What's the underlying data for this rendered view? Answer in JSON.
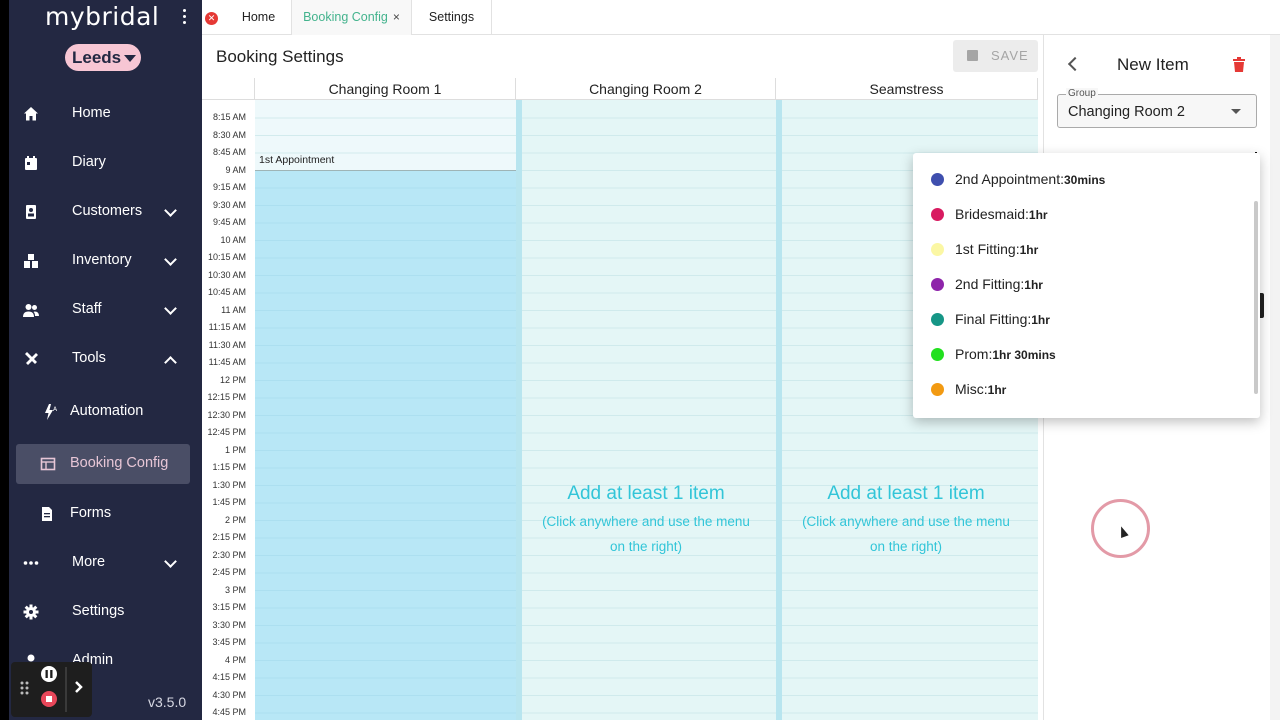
{
  "app": {
    "logo": "mybridal",
    "location": "Leeds",
    "version": "v3.5.0"
  },
  "sidebar": {
    "items": [
      {
        "label": "Home",
        "icon": "home-icon"
      },
      {
        "label": "Diary",
        "icon": "calendar-icon"
      },
      {
        "label": "Customers",
        "icon": "contact-icon"
      },
      {
        "label": "Inventory",
        "icon": "boxes-icon"
      },
      {
        "label": "Staff",
        "icon": "people-icon"
      },
      {
        "label": "Tools",
        "icon": "tools-icon"
      },
      {
        "label": "Automation",
        "icon": "automation-icon"
      },
      {
        "label": "Booking Config",
        "icon": "table-icon"
      },
      {
        "label": "Forms",
        "icon": "document-icon"
      },
      {
        "label": "More",
        "icon": "more-icon"
      },
      {
        "label": "Settings",
        "icon": "gear-icon"
      },
      {
        "label": "Admin",
        "icon": "person-icon"
      }
    ]
  },
  "tabs": [
    {
      "label": "Home"
    },
    {
      "label": "Booking Config",
      "close": "×"
    },
    {
      "label": "Settings"
    }
  ],
  "main": {
    "title": "Booking Settings",
    "save_label": "SAVE",
    "columns": [
      "Changing Room 1",
      "Changing Room 2",
      "Seamstress"
    ],
    "times": [
      "8:15 AM",
      "8:30 AM",
      "8:45 AM",
      "9 AM",
      "9:15 AM",
      "9:30 AM",
      "9:45 AM",
      "10 AM",
      "10:15 AM",
      "10:30 AM",
      "10:45 AM",
      "11 AM",
      "11:15 AM",
      "11:30 AM",
      "11:45 AM",
      "12 PM",
      "12:15 PM",
      "12:30 PM",
      "12:45 PM",
      "1 PM",
      "1:15 PM",
      "1:30 PM",
      "1:45 PM",
      "2 PM",
      "2:15 PM",
      "2:30 PM",
      "2:45 PM",
      "3 PM",
      "3:15 PM",
      "3:30 PM",
      "3:45 PM",
      "4 PM",
      "4:15 PM",
      "4:30 PM",
      "4:45 PM"
    ],
    "appointment": "1st Appointment",
    "empty_title": "Add at least 1 item",
    "empty_hint_1": "(Click anywhere and use the menu",
    "empty_hint_2": "on the right)",
    "colors": {
      "filled": "#b8e7f6",
      "empty": "#e4f6f6",
      "accent": "#32c5d8"
    }
  },
  "panel": {
    "title": "New Item",
    "group_label": "Group",
    "group_value": "Changing Room 2"
  },
  "dropdown": [
    {
      "name": "2nd Appointment:",
      "duration": "30mins",
      "color": "#3f4fae"
    },
    {
      "name": "Bridesmaid:",
      "duration": "1hr",
      "color": "#d81b60"
    },
    {
      "name": "1st Fitting:",
      "duration": "1hr",
      "color": "#fbf7a4"
    },
    {
      "name": "2nd Fitting:",
      "duration": "1hr",
      "color": "#8e24aa"
    },
    {
      "name": "Final Fitting:",
      "duration": "1hr",
      "color": "#169686"
    },
    {
      "name": "Prom:",
      "duration": "1hr 30mins",
      "color": "#22e01f"
    },
    {
      "name": "Misc:",
      "duration": "1hr",
      "color": "#f29a12"
    }
  ]
}
